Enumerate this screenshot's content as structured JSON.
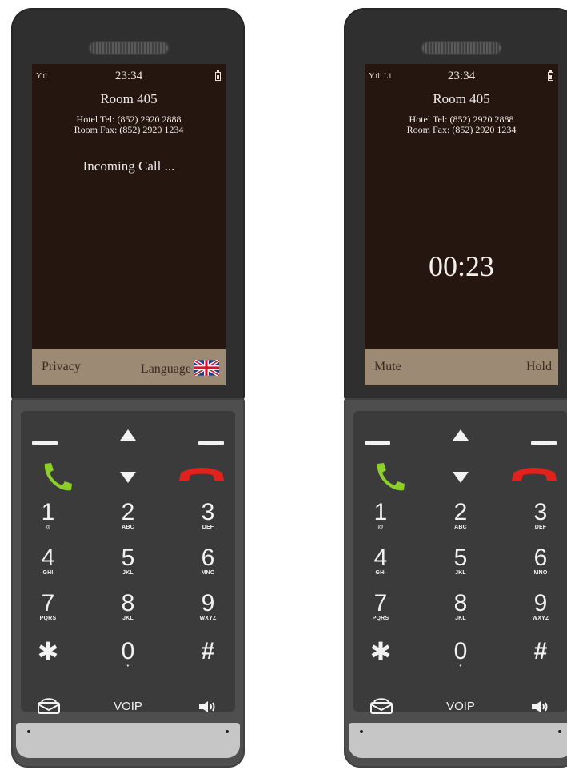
{
  "phones": [
    {
      "signal": "Y.ıl",
      "line": "",
      "time": "23:34",
      "room": "Room 405",
      "hotel_tel": "Hotel Tel:  (852) 2920 2888",
      "room_fax": "Room Fax: (852) 2920 1234",
      "status": "Incoming Call ...",
      "timer": "",
      "soft_left": "Privacy",
      "soft_right": "Language"
    },
    {
      "signal": "Y.ıl",
      "line": "L1",
      "time": "23:34",
      "room": "Room 405",
      "hotel_tel": "Hotel Tel:  (852) 2920 2888",
      "room_fax": "Room Fax: (852) 2920 1234",
      "status": "",
      "timer": "00:23",
      "soft_left": "Mute",
      "soft_right": "Hold"
    }
  ],
  "keypad": {
    "keys": [
      {
        "digit": "1",
        "letters": "@"
      },
      {
        "digit": "2",
        "letters": "ABC"
      },
      {
        "digit": "3",
        "letters": "DEF"
      },
      {
        "digit": "4",
        "letters": "GHI"
      },
      {
        "digit": "5",
        "letters": "JKL"
      },
      {
        "digit": "6",
        "letters": "MNO"
      },
      {
        "digit": "7",
        "letters": "PQRS"
      },
      {
        "digit": "8",
        "letters": "JKL"
      },
      {
        "digit": "9",
        "letters": "WXYZ"
      },
      {
        "digit": "✱",
        "letters": ""
      },
      {
        "digit": "0",
        "letters": "•"
      },
      {
        "digit": "#",
        "letters": ""
      }
    ],
    "voip_label": "VOIP",
    "icons": {
      "nav_up": "nav-up-arrow-icon",
      "nav_down": "nav-down-arrow-icon",
      "call": "call-answer-icon",
      "hangup": "call-end-icon",
      "voicemail": "voicemail-icon",
      "speaker": "speaker-icon",
      "language_flag": "uk-flag-icon"
    }
  },
  "colors": {
    "screen_bg": "#261610",
    "softbar_bg": "#9d8a74",
    "call_green": "#8ccf2a",
    "hangup_red": "#e0221d",
    "body_dark": "#2f2f2f",
    "keypad_bg": "#3b3b3b"
  }
}
